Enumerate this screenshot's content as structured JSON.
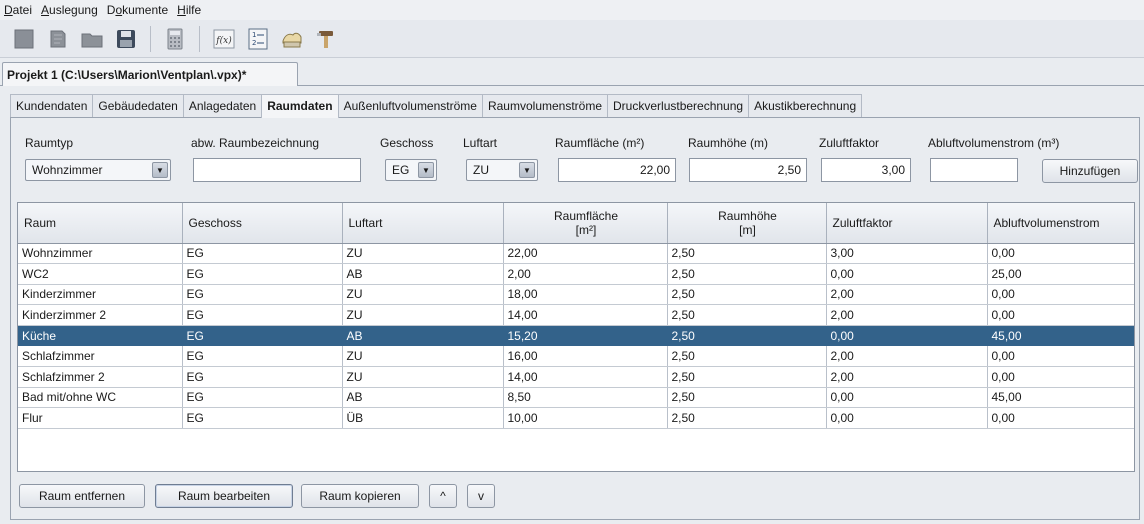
{
  "menu": [
    {
      "pre": "",
      "u": "D",
      "post": "atei"
    },
    {
      "pre": "",
      "u": "A",
      "post": "uslegung"
    },
    {
      "pre": "D",
      "u": "o",
      "post": "kumente"
    },
    {
      "pre": "",
      "u": "H",
      "post": "ilfe"
    }
  ],
  "toolbar_icons": [
    "new-document-icon",
    "open-document-icon",
    "folder-icon",
    "save-icon",
    "calculator-icon",
    "function-icon",
    "list-icon",
    "print-icon",
    "tools-icon"
  ],
  "project_tab": "Projekt 1 (C:\\Users\\Marion\\Ventplan\\.vpx)*",
  "tabs": [
    "Kundendaten",
    "Gebäudedaten",
    "Anlagedaten",
    "Raumdaten",
    "Außenluftvolumenströme",
    "Raumvolumenströme",
    "Druckverlustberechnung",
    "Akustikberechnung"
  ],
  "active_tab": "Raumdaten",
  "form": {
    "raumtyp_label": "Raumtyp",
    "raumtyp_value": "Wohnzimmer",
    "bezeichnung_label": "abw. Raumbezeichnung",
    "bezeichnung_value": "",
    "geschoss_label": "Geschoss",
    "geschoss_value": "EG",
    "luftart_label": "Luftart",
    "luftart_value": "ZU",
    "flaeche_label": "Raumfläche (m²)",
    "flaeche_value": "22,00",
    "hoehe_label": "Raumhöhe (m)",
    "hoehe_value": "2,50",
    "faktor_label": "Zuluftfaktor",
    "faktor_value": "3,00",
    "abluft_label": "Abluftvolumenstrom (m³)",
    "abluft_value": "",
    "add_button": "Hinzufügen"
  },
  "table": {
    "headers": [
      "Raum",
      "Geschoss",
      "Luftart",
      "Raumfläche\n[m²]",
      "Raumhöhe\n[m]",
      "Zuluftfaktor",
      "Abluftvolumenstrom"
    ],
    "rows": [
      [
        "Wohnzimmer",
        "EG",
        "ZU",
        "22,00",
        "2,50",
        "3,00",
        "0,00"
      ],
      [
        "WC2",
        "EG",
        "AB",
        "2,00",
        "2,50",
        "0,00",
        "25,00"
      ],
      [
        "Kinderzimmer",
        "EG",
        "ZU",
        "18,00",
        "2,50",
        "2,00",
        "0,00"
      ],
      [
        "Kinderzimmer 2",
        "EG",
        "ZU",
        "14,00",
        "2,50",
        "2,00",
        "0,00"
      ],
      [
        "Küche",
        "EG",
        "AB",
        "15,20",
        "2,50",
        "0,00",
        "45,00"
      ],
      [
        "Schlafzimmer",
        "EG",
        "ZU",
        "16,00",
        "2,50",
        "2,00",
        "0,00"
      ],
      [
        "Schlafzimmer 2",
        "EG",
        "ZU",
        "14,00",
        "2,50",
        "2,00",
        "0,00"
      ],
      [
        "Bad mit/ohne WC",
        "EG",
        "AB",
        "8,50",
        "2,50",
        "0,00",
        "45,00"
      ],
      [
        "Flur",
        "EG",
        "ÜB",
        "10,00",
        "2,50",
        "0,00",
        "0,00"
      ]
    ],
    "selected_row": 4
  },
  "buttons": {
    "remove": "Raum entfernen",
    "edit": "Raum bearbeiten",
    "copy": "Raum kopieren",
    "up": "^",
    "down": "v"
  }
}
